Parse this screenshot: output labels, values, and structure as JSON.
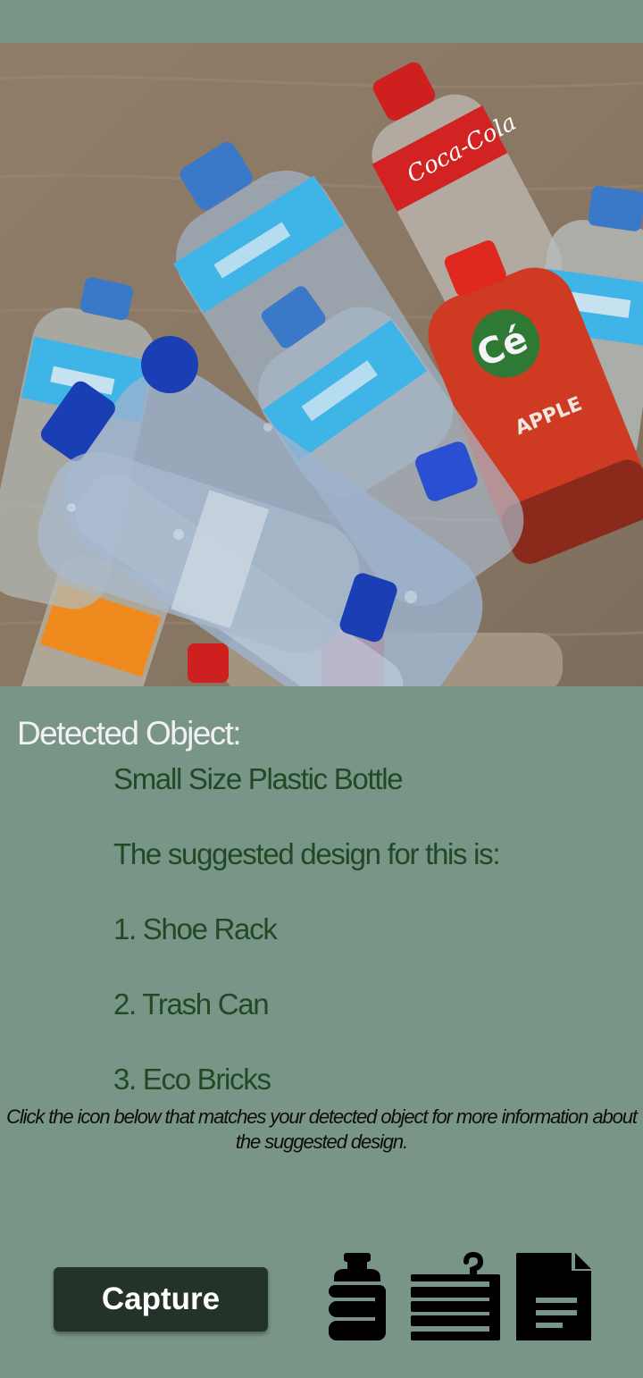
{
  "photo": {
    "subject": "pile of used plastic bottles on a wooden table",
    "colors": {
      "table": "#8b7a66",
      "cap_blue": "#3a78c8",
      "cap_navy": "#1a3fb5",
      "cap_red": "#cf2020",
      "label_cyan": "#3fb4e6",
      "label_orange": "#ef8a1f"
    },
    "label_text": {
      "cola_script": "Coca-Cola",
      "juice_brand": "Cé",
      "juice_flavor": "APPLE"
    }
  },
  "detection": {
    "heading": "Detected Object:",
    "object_name": "Small Size Plastic Bottle",
    "suggestion_intro": "The suggested design for this is:",
    "suggestions": [
      "1. Shoe Rack",
      "2. Trash Can",
      "3. Eco Bricks"
    ]
  },
  "instruction": "Click the icon below that matches your detected object for more information about the suggested design.",
  "actions": {
    "capture_label": "Capture",
    "icons": [
      "water-jug-icon",
      "clothes-rack-icon",
      "document-icon"
    ]
  },
  "colors": {
    "background": "#789588",
    "heading_text": "#f2f2f2",
    "result_text": "#1f4a24",
    "button_bg": "#24332a",
    "button_text": "#ffffff",
    "icon": "#000000"
  }
}
